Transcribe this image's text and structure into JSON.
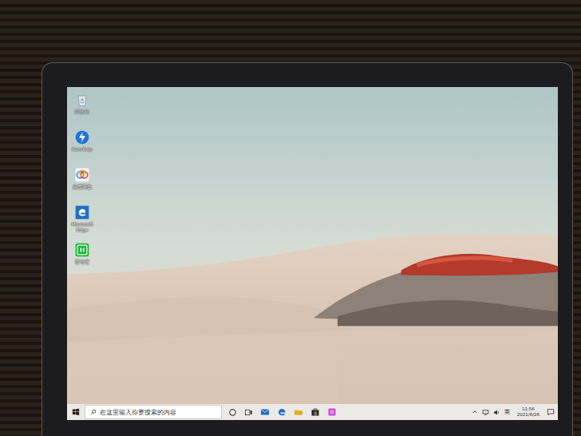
{
  "desktop": {
    "icons": [
      {
        "label": "回收站"
      },
      {
        "label": "Bandizip"
      },
      {
        "label": "百度网盘"
      },
      {
        "label": "Microsoft Edge"
      },
      {
        "label": "爱奇艺"
      }
    ]
  },
  "taskbar": {
    "search": {
      "placeholder": "在这里输入你要搜索的内容"
    },
    "tray": {
      "input_method": "英",
      "time": "11:56",
      "date": "2021/6/26"
    }
  }
}
